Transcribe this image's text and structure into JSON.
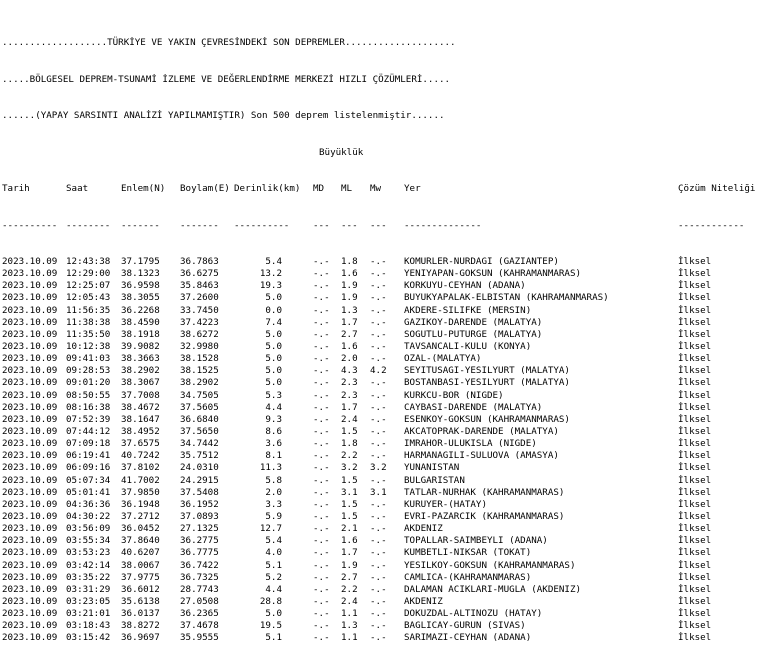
{
  "header": {
    "line1": "...................TÜRKİYE VE YAKIN ÇEVRESİNDEKİ SON DEPREMLER....................",
    "line2": ".....BÖLGESEL DEPREM-TSUNAMİ İZLEME VE DEĞERLENDİRME MERKEZİ HIZLI ÇÖZÜMLERİ.....",
    "line3": "......(YAPAY SARSINTI ANALİZİ YAPILMAMIŞTIR) Son 500 deprem listelenmiştir......"
  },
  "columns": {
    "buyukluk": "Büyüklük",
    "tarih": "Tarih",
    "saat": "Saat",
    "enlem": "Enlem(N)",
    "boylam": "Boylam(E)",
    "derinlik": "Derinlik(km)",
    "md": "MD",
    "ml": "ML",
    "mw": "Mw",
    "yer": "Yer",
    "cozum": "Çözüm Niteliği"
  },
  "separators": {
    "tarih": "----------",
    "saat": "--------",
    "enlem": "-------",
    "boylam": "-------",
    "derinlik": "----------",
    "md": "---",
    "ml": "---",
    "mw": "---",
    "yer": "--------------",
    "cozum": "------------"
  },
  "rows": [
    {
      "tarih": "2023.10.09",
      "saat": "12:43:38",
      "enlem": "37.1795",
      "boylam": "36.7863",
      "derinlik": "5.4",
      "md": "-.-",
      "ml": "1.8",
      "mw": "-.-",
      "yer": "KOMURLER-NURDAGI (GAZIANTEP)",
      "cozum": "İlksel"
    },
    {
      "tarih": "2023.10.09",
      "saat": "12:29:00",
      "enlem": "38.1323",
      "boylam": "36.6275",
      "derinlik": "13.2",
      "md": "-.-",
      "ml": "1.6",
      "mw": "-.-",
      "yer": "YENIYAPAN-GOKSUN (KAHRAMANMARAS)",
      "cozum": "İlksel"
    },
    {
      "tarih": "2023.10.09",
      "saat": "12:25:07",
      "enlem": "36.9598",
      "boylam": "35.8463",
      "derinlik": "19.3",
      "md": "-.-",
      "ml": "1.9",
      "mw": "-.-",
      "yer": "KORKUYU-CEYHAN (ADANA)",
      "cozum": "İlksel"
    },
    {
      "tarih": "2023.10.09",
      "saat": "12:05:43",
      "enlem": "38.3055",
      "boylam": "37.2600",
      "derinlik": "5.0",
      "md": "-.-",
      "ml": "1.9",
      "mw": "-.-",
      "yer": "BUYUKYAPALAK-ELBISTAN (KAHRAMANMARAS)",
      "cozum": "İlksel"
    },
    {
      "tarih": "2023.10.09",
      "saat": "11:56:35",
      "enlem": "36.2268",
      "boylam": "33.7450",
      "derinlik": "0.0",
      "md": "-.-",
      "ml": "1.3",
      "mw": "-.-",
      "yer": "AKDERE-SILIFKE (MERSIN)",
      "cozum": "İlksel"
    },
    {
      "tarih": "2023.10.09",
      "saat": "11:38:38",
      "enlem": "38.4590",
      "boylam": "37.4223",
      "derinlik": "7.4",
      "md": "-.-",
      "ml": "1.7",
      "mw": "-.-",
      "yer": "GAZIKOY-DARENDE (MALATYA)",
      "cozum": "İlksel"
    },
    {
      "tarih": "2023.10.09",
      "saat": "11:35:50",
      "enlem": "38.1918",
      "boylam": "38.6272",
      "derinlik": "5.0",
      "md": "-.-",
      "ml": "2.7",
      "mw": "-.-",
      "yer": "SOGUTLU-PUTURGE (MALATYA)",
      "cozum": "İlksel"
    },
    {
      "tarih": "2023.10.09",
      "saat": "10:12:38",
      "enlem": "39.9082",
      "boylam": "32.9980",
      "derinlik": "5.0",
      "md": "-.-",
      "ml": "1.6",
      "mw": "-.-",
      "yer": "TAVSANCALI-KULU (KONYA)",
      "cozum": "İlksel"
    },
    {
      "tarih": "2023.10.09",
      "saat": "09:41:03",
      "enlem": "38.3663",
      "boylam": "38.1528",
      "derinlik": "5.0",
      "md": "-.-",
      "ml": "2.0",
      "mw": "-.-",
      "yer": "OZAL-(MALATYA)",
      "cozum": "İlksel"
    },
    {
      "tarih": "2023.10.09",
      "saat": "09:28:53",
      "enlem": "38.2902",
      "boylam": "38.1525",
      "derinlik": "5.0",
      "md": "-.-",
      "ml": "4.3",
      "mw": "4.2",
      "yer": "SEYITUSAGI-YESILYURT (MALATYA)",
      "cozum": "İlksel"
    },
    {
      "tarih": "2023.10.09",
      "saat": "09:01:20",
      "enlem": "38.3067",
      "boylam": "38.2902",
      "derinlik": "5.0",
      "md": "-.-",
      "ml": "2.3",
      "mw": "-.-",
      "yer": "BOSTANBASI-YESILYURT (MALATYA)",
      "cozum": "İlksel"
    },
    {
      "tarih": "2023.10.09",
      "saat": "08:50:55",
      "enlem": "37.7008",
      "boylam": "34.7505",
      "derinlik": "5.3",
      "md": "-.-",
      "ml": "2.3",
      "mw": "-.-",
      "yer": "KURKCU-BOR (NIGDE)",
      "cozum": "İlksel"
    },
    {
      "tarih": "2023.10.09",
      "saat": "08:16:38",
      "enlem": "38.4672",
      "boylam": "37.5605",
      "derinlik": "4.4",
      "md": "-.-",
      "ml": "1.7",
      "mw": "-.-",
      "yer": "CAYBASI-DARENDE (MALATYA)",
      "cozum": "İlksel"
    },
    {
      "tarih": "2023.10.09",
      "saat": "07:52:39",
      "enlem": "38.1647",
      "boylam": "36.6840",
      "derinlik": "9.3",
      "md": "-.-",
      "ml": "2.4",
      "mw": "-.-",
      "yer": "ESENKOY-GOKSUN (KAHRAMANMARAS)",
      "cozum": "İlksel"
    },
    {
      "tarih": "2023.10.09",
      "saat": "07:44:12",
      "enlem": "38.4952",
      "boylam": "37.5650",
      "derinlik": "8.6",
      "md": "-.-",
      "ml": "1.5",
      "mw": "-.-",
      "yer": "AKCATOPRAK-DARENDE (MALATYA)",
      "cozum": "İlksel"
    },
    {
      "tarih": "2023.10.09",
      "saat": "07:09:18",
      "enlem": "37.6575",
      "boylam": "34.7442",
      "derinlik": "3.6",
      "md": "-.-",
      "ml": "1.8",
      "mw": "-.-",
      "yer": "IMRAHOR-ULUKISLA (NIGDE)",
      "cozum": "İlksel"
    },
    {
      "tarih": "2023.10.09",
      "saat": "06:19:41",
      "enlem": "40.7242",
      "boylam": "35.7512",
      "derinlik": "8.1",
      "md": "-.-",
      "ml": "2.2",
      "mw": "-.-",
      "yer": "HARMANAGILI-SULUOVA (AMASYA)",
      "cozum": "İlksel"
    },
    {
      "tarih": "2023.10.09",
      "saat": "06:09:16",
      "enlem": "37.8102",
      "boylam": "24.0310",
      "derinlik": "11.3",
      "md": "-.-",
      "ml": "3.2",
      "mw": "3.2",
      "yer": "YUNANISTAN",
      "cozum": "İlksel"
    },
    {
      "tarih": "2023.10.09",
      "saat": "05:07:34",
      "enlem": "41.7002",
      "boylam": "24.2915",
      "derinlik": "5.8",
      "md": "-.-",
      "ml": "1.5",
      "mw": "-.-",
      "yer": "BULGARISTAN",
      "cozum": "İlksel"
    },
    {
      "tarih": "2023.10.09",
      "saat": "05:01:41",
      "enlem": "37.9850",
      "boylam": "37.5408",
      "derinlik": "2.0",
      "md": "-.-",
      "ml": "3.1",
      "mw": "3.1",
      "yer": "TATLAR-NURHAK (KAHRAMANMARAS)",
      "cozum": "İlksel"
    },
    {
      "tarih": "2023.10.09",
      "saat": "04:36:36",
      "enlem": "36.1948",
      "boylam": "36.1952",
      "derinlik": "3.3",
      "md": "-.-",
      "ml": "1.5",
      "mw": "-.-",
      "yer": "KURUYER-(HATAY)",
      "cozum": "İlksel"
    },
    {
      "tarih": "2023.10.09",
      "saat": "04:30:22",
      "enlem": "37.2712",
      "boylam": "37.0893",
      "derinlik": "5.9",
      "md": "-.-",
      "ml": "1.5",
      "mw": "-.-",
      "yer": "EVRI-PAZARCIK (KAHRAMANMARAS)",
      "cozum": "İlksel"
    },
    {
      "tarih": "2023.10.09",
      "saat": "03:56:09",
      "enlem": "36.0452",
      "boylam": "27.1325",
      "derinlik": "12.7",
      "md": "-.-",
      "ml": "2.1",
      "mw": "-.-",
      "yer": "AKDENIZ",
      "cozum": "İlksel"
    },
    {
      "tarih": "2023.10.09",
      "saat": "03:55:34",
      "enlem": "37.8640",
      "boylam": "36.2775",
      "derinlik": "5.4",
      "md": "-.-",
      "ml": "1.6",
      "mw": "-.-",
      "yer": "TOPALLAR-SAIMBEYLI (ADANA)",
      "cozum": "İlksel"
    },
    {
      "tarih": "2023.10.09",
      "saat": "03:53:23",
      "enlem": "40.6207",
      "boylam": "36.7775",
      "derinlik": "4.0",
      "md": "-.-",
      "ml": "1.7",
      "mw": "-.-",
      "yer": "KUMBETLI-NIKSAR (TOKAT)",
      "cozum": "İlksel"
    },
    {
      "tarih": "2023.10.09",
      "saat": "03:42:14",
      "enlem": "38.0067",
      "boylam": "36.7422",
      "derinlik": "5.1",
      "md": "-.-",
      "ml": "1.9",
      "mw": "-.-",
      "yer": "YESILKOY-GOKSUN (KAHRAMANMARAS)",
      "cozum": "İlksel"
    },
    {
      "tarih": "2023.10.09",
      "saat": "03:35:22",
      "enlem": "37.9775",
      "boylam": "36.7325",
      "derinlik": "5.2",
      "md": "-.-",
      "ml": "2.7",
      "mw": "-.-",
      "yer": "CAMLICA-(KAHRAMANMARAS)",
      "cozum": "İlksel"
    },
    {
      "tarih": "2023.10.09",
      "saat": "03:31:29",
      "enlem": "36.6012",
      "boylam": "28.7743",
      "derinlik": "4.4",
      "md": "-.-",
      "ml": "2.2",
      "mw": "-.-",
      "yer": "DALAMAN ACIKLARI-MUGLA (AKDENIZ)",
      "cozum": "İlksel"
    },
    {
      "tarih": "2023.10.09",
      "saat": "03:23:05",
      "enlem": "35.6138",
      "boylam": "27.0508",
      "derinlik": "28.8",
      "md": "-.-",
      "ml": "2.4",
      "mw": "-.-",
      "yer": "AKDENIZ",
      "cozum": "İlksel"
    },
    {
      "tarih": "2023.10.09",
      "saat": "03:21:01",
      "enlem": "36.0137",
      "boylam": "36.2365",
      "derinlik": "5.0",
      "md": "-.-",
      "ml": "1.1",
      "mw": "-.-",
      "yer": "DOKUZDAL-ALTINOZU (HATAY)",
      "cozum": "İlksel"
    },
    {
      "tarih": "2023.10.09",
      "saat": "03:18:43",
      "enlem": "38.8272",
      "boylam": "37.4678",
      "derinlik": "19.5",
      "md": "-.-",
      "ml": "1.3",
      "mw": "-.-",
      "yer": "BAGLICAY-GURUN (SIVAS)",
      "cozum": "İlksel"
    },
    {
      "tarih": "2023.10.09",
      "saat": "03:15:42",
      "enlem": "36.9697",
      "boylam": "35.9555",
      "derinlik": "5.1",
      "md": "-.-",
      "ml": "1.1",
      "mw": "-.-",
      "yer": "SARIMAZI-CEYHAN (ADANA)",
      "cozum": "İlksel"
    }
  ]
}
